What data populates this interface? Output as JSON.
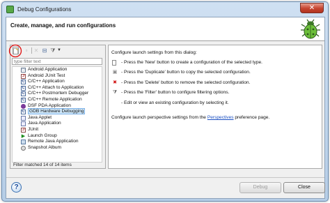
{
  "window": {
    "title": "Debug Configurations",
    "close_label": "✕"
  },
  "banner": {
    "title": "Create, manage, and run configurations"
  },
  "toolbar": {
    "new_icon": "new-config-icon",
    "duplicate_icon": "duplicate-icon",
    "delete_icon": "delete-icon",
    "collapse_icon": "collapse-all-icon",
    "filter_icon": "filter-icon",
    "highlight_color": "#e01010"
  },
  "filter": {
    "placeholder": "type filter text"
  },
  "tree": {
    "items": [
      {
        "label": "Android Application",
        "icon": "app-icon"
      },
      {
        "label": "Android JUnit Test",
        "icon": "junit-icon"
      },
      {
        "label": "C/C++ Application",
        "icon": "c-icon"
      },
      {
        "label": "C/C++ Attach to Application",
        "icon": "c-icon"
      },
      {
        "label": "C/C++ Postmortem Debugger",
        "icon": "c-icon"
      },
      {
        "label": "C/C++ Remote Application",
        "icon": "c-icon"
      },
      {
        "label": "DSF PDA Application",
        "icon": "dsf-icon"
      },
      {
        "label": "GDB Hardware Debugging",
        "icon": "c-icon",
        "selected": true
      },
      {
        "label": "Java Applet",
        "icon": "java-icon"
      },
      {
        "label": "Java Application",
        "icon": "java-icon"
      },
      {
        "label": "JUnit",
        "icon": "junit-icon"
      },
      {
        "label": "Launch Group",
        "icon": "run-icon"
      },
      {
        "label": "Remote Java Application",
        "icon": "remote-icon"
      },
      {
        "label": "Snapshot Album",
        "icon": "snapshot-icon"
      }
    ],
    "status": "Filter matched 14 of 14 items"
  },
  "right": {
    "intro": "Configure launch settings from this dialog:",
    "new_text": "- Press the 'New' button to create a configuration of the selected type.",
    "duplicate_text": "- Press the 'Duplicate' button to copy the selected configuration.",
    "delete_text": "- Press the 'Delete' button to remove the selected configuration.",
    "filter_text": "- Press the 'Filter' button to configure filtering options.",
    "edit_text": "- Edit or view an existing configuration by selecting it.",
    "persp_prefix": "Configure launch perspective settings from the ",
    "persp_link": "Perspectives",
    "persp_suffix": " preference page."
  },
  "buttons": {
    "debug": "Debug",
    "close": "Close",
    "help": "?"
  }
}
